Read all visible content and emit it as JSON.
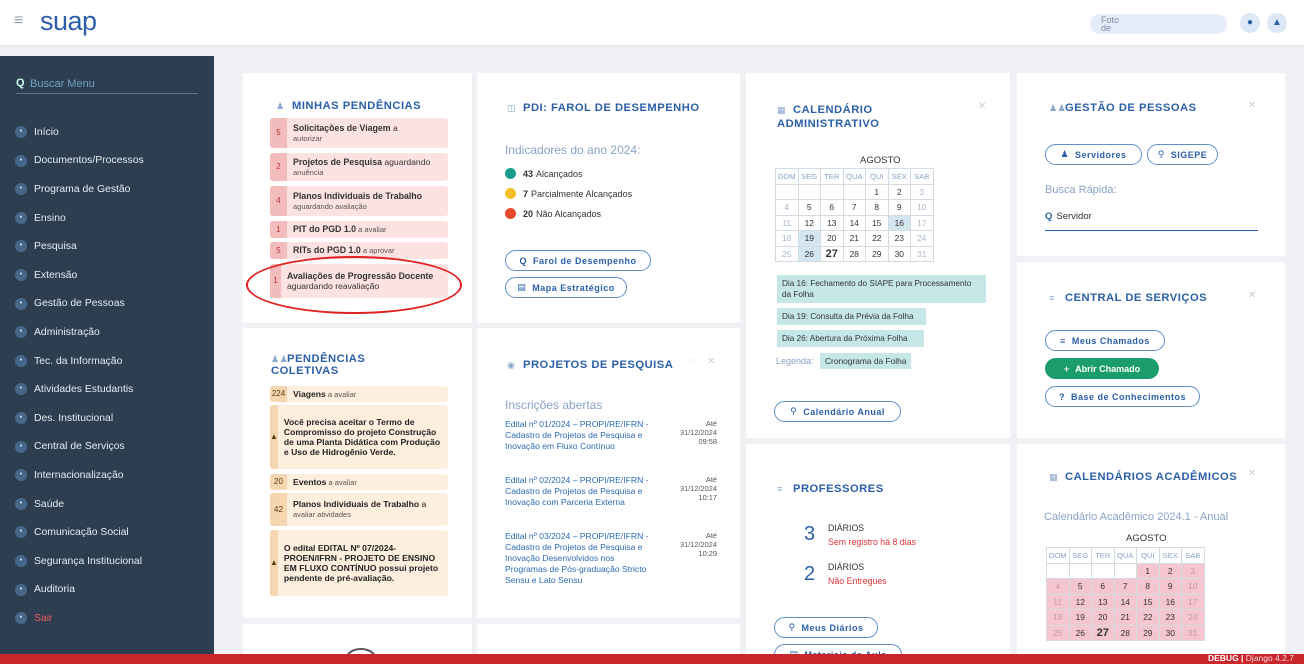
{
  "topbar": {
    "logo": "suap",
    "photo_label": "Foto\nde"
  },
  "sidebar": {
    "search_placeholder": "Buscar Menu",
    "items": [
      {
        "label": "Início",
        "icon": "home-icon"
      },
      {
        "label": "Documentos/Processos",
        "icon": "document-icon"
      },
      {
        "label": "Programa de Gestão",
        "icon": "program-icon"
      },
      {
        "label": "Ensino",
        "icon": "book-icon"
      },
      {
        "label": "Pesquisa",
        "icon": "research-icon"
      },
      {
        "label": "Extensão",
        "icon": "extension-icon"
      },
      {
        "label": "Gestão de Pessoas",
        "icon": "people-icon"
      },
      {
        "label": "Administração",
        "icon": "admin-icon"
      },
      {
        "label": "Tec. da Informação",
        "icon": "monitor-icon"
      },
      {
        "label": "Atividades Estudantis",
        "icon": "student-icon"
      },
      {
        "label": "Des. Institucional",
        "icon": "chart-icon"
      },
      {
        "label": "Central de Serviços",
        "icon": "service-icon"
      },
      {
        "label": "Internacionalização",
        "icon": "globe-icon"
      },
      {
        "label": "Saúde",
        "icon": "health-icon"
      },
      {
        "label": "Comunicação Social",
        "icon": "chat-icon"
      },
      {
        "label": "Segurança Institucional",
        "icon": "shield-icon"
      },
      {
        "label": "Auditoria",
        "icon": "audit-icon"
      },
      {
        "label": "Sair",
        "icon": "logout-icon"
      }
    ]
  },
  "pendencias": {
    "title": "MINHAS PENDÊNCIAS",
    "items": [
      {
        "n": "5",
        "bold": "Solicitações de Viagem",
        "rest": " a",
        "small": "autorizar"
      },
      {
        "n": "2",
        "bold": "Projetos de Pesquisa",
        "rest": " aguardando",
        "small": "anuência"
      },
      {
        "n": "4",
        "bold": "Planos Individuais de Trabalho",
        "rest": "",
        "small": "aguardando avaliação"
      },
      {
        "n": "1",
        "bold": "PIT do PGD 1.0",
        "rest": "",
        "small": " a avaliar"
      },
      {
        "n": "5",
        "bold": "RITs do PGD 1.0",
        "rest": "",
        "small": " a aprovar"
      },
      {
        "n": "1",
        "bold": "Avaliações de Progressão Docente",
        "rest": " aguardando reavaliação",
        "small": ""
      }
    ]
  },
  "coletivas": {
    "title": "PENDÊNCIAS COLETIVAS",
    "items": [
      {
        "n": "224",
        "bold": "Viagens",
        "small": " a avaliar"
      },
      {
        "n": "▲",
        "text": "Você precisa aceitar o Termo de Compromisso do projeto Construção de uma Planta Didática com Produção e Uso de Hidrogênio Verde."
      },
      {
        "n": "20",
        "bold": "Eventos",
        "small": " a avaliar"
      },
      {
        "n": "42",
        "bold": "Planos Individuais de Trabalho",
        "rest": " a",
        "small": "avaliar atividades"
      },
      {
        "n": "▲",
        "text": "O edital EDITAL Nº 07/2024-PROEN/IFRN - PROJETO DE ENSINO EM FLUXO CONTÍNUO possui projeto pendente de pré-avaliação."
      }
    ]
  },
  "pdi": {
    "title": "PDI: FAROL DE DESEMPENHO",
    "subtitle": "Indicadores do ano 2024:",
    "legend": [
      {
        "count": "43",
        "label": "Alcançados",
        "color": "#1a9c8c"
      },
      {
        "count": "7",
        "label": "Parcialmente Alcançados",
        "color": "#f5c02c"
      },
      {
        "count": "20",
        "label": "Não Alcançados",
        "color": "#e6492d"
      }
    ],
    "btn_farol": "Farol de Desempenho",
    "btn_mapa": "Mapa Estratégico"
  },
  "projetos": {
    "title": "PROJETOS DE PESQUISA",
    "subtitle": "Inscrições abertas",
    "editais": [
      {
        "text": "Edital nº 01/2024 – PROPI/RE/IFRN - Cadastro de Projetos de Pesquisa e Inovação em Fluxo Contínuo",
        "ate": "Até",
        "date": "31/12/2024",
        "time": "09:58"
      },
      {
        "text": "Edital nº 02/2024 – PROPI/RE/IFRN - Cadastro de Projetos de Pesquisa e Inovação com Parceria Externa",
        "ate": "Até",
        "date": "31/12/2024",
        "time": "10:17"
      },
      {
        "text": "Edital nº 03/2024 – PROPI/RE/IFRN - Cadastro de Projetos de Pesquisa e Inovação Desenvolvidos nos Programas de Pós-graduação Stricto Sensu e Lato Sensu",
        "ate": "Até",
        "date": "31/12/2024",
        "time": "10:29"
      }
    ]
  },
  "calendario": {
    "title1": "CALENDÁRIO",
    "title2": "ADMINISTRATIVO",
    "month": "AGOSTO",
    "weekdays": [
      "DOM",
      "SEG",
      "TER",
      "QUA",
      "QUI",
      "SEX",
      "SAB"
    ],
    "events": [
      "Dia 16: Fechamento do SIAPE para Processamento da Folha",
      "Dia 19: Consulta da Prévia da Folha",
      "Dia 26: Abertura da Próxima Folha"
    ],
    "legend_label": "Legenda:",
    "legend_item": "Cronograma da Folha",
    "btn_anual": "Calendário Anual"
  },
  "professores": {
    "title": "PROFESSORES",
    "stat1": {
      "num": "3",
      "label": "DIÁRIOS",
      "red": "Sem registro há 8 dias"
    },
    "stat2": {
      "num": "2",
      "label": "DIÁRIOS",
      "red": "Não Entregues"
    },
    "btn_diarios": "Meus Diários",
    "btn_materiais": "Materiais de Aula"
  },
  "gestao": {
    "title": "GESTÃO DE PESSOAS",
    "btn_servidores": "Servidores",
    "btn_sigepe": "SIGEPE",
    "busca_label": "Busca Rápida:",
    "busca_placeholder": "Servidor"
  },
  "central": {
    "title": "CENTRAL DE SERVIÇOS",
    "btn_chamados": "Meus Chamados",
    "btn_abrir": "Abrir Chamado",
    "btn_base": "Base de Conhecimentos"
  },
  "academicos": {
    "title": "CALENDÁRIOS ACADÊMICOS",
    "subtitle": "Calendário Acadêmico 2024.1 - Anual",
    "month": "AGOSTO",
    "weekdays": [
      "DOM",
      "SEG",
      "TER",
      "QUA",
      "QUI",
      "SEX",
      "SAB"
    ]
  },
  "footer": {
    "debug": "DEBUG",
    "django": "Django 4.2.7"
  }
}
